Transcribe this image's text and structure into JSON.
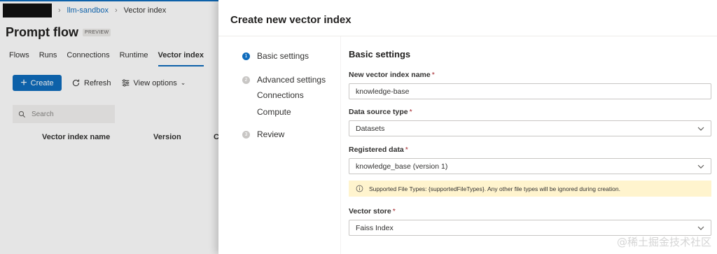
{
  "breadcrumb": {
    "workspace": "llm-sandbox",
    "current": "Vector index"
  },
  "page": {
    "title": "Prompt flow",
    "badge": "PREVIEW"
  },
  "tabs": [
    "Flows",
    "Runs",
    "Connections",
    "Runtime",
    "Vector index"
  ],
  "active_tab": "Vector index",
  "toolbar": {
    "create": "Create",
    "refresh": "Refresh",
    "view_options": "View options"
  },
  "search": {
    "placeholder": "Search"
  },
  "grid": {
    "col1": "Vector index name",
    "col2": "Version",
    "col3": "C"
  },
  "panel": {
    "title": "Create new vector index",
    "steps": {
      "s1": {
        "num": "1",
        "label": "Basic settings"
      },
      "s2": {
        "num": "2",
        "label": "Advanced settings"
      },
      "sub1": "Connections",
      "sub2": "Compute",
      "s3": {
        "num": "3",
        "label": "Review"
      }
    },
    "form": {
      "section": "Basic settings",
      "name_label": "New vector index name",
      "name_value": "knowledge-base",
      "source_label": "Data source type",
      "source_value": "Datasets",
      "registered_label": "Registered data",
      "registered_value": "knowledge_base (version 1)",
      "info": "Supported File Types: {supportedFileTypes}. Any other file types will be ignored during creation.",
      "store_label": "Vector store",
      "store_value": "Faiss Index",
      "required_mark": "*"
    }
  },
  "watermark": "@稀土掘金技术社区",
  "colors": {
    "accent": "#0f6cbd",
    "info_bg": "#fff4ce",
    "required": "#a4262c"
  }
}
